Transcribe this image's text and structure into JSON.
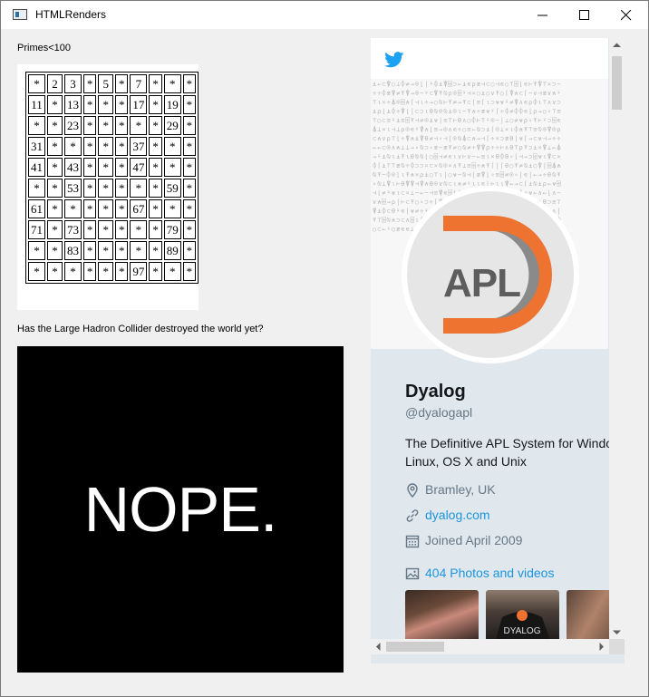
{
  "window": {
    "title": "HTMLRenders"
  },
  "primes": {
    "caption": "Primes<100",
    "rows": [
      [
        "*",
        "2",
        "3",
        "*",
        "5",
        "*",
        "7",
        "*",
        "*",
        "*"
      ],
      [
        "11",
        "*",
        "13",
        "*",
        "*",
        "*",
        "17",
        "*",
        "19",
        "*"
      ],
      [
        "*",
        "*",
        "23",
        "*",
        "*",
        "*",
        "*",
        "*",
        "29",
        "*"
      ],
      [
        "31",
        "*",
        "*",
        "*",
        "*",
        "*",
        "37",
        "*",
        "*",
        "*"
      ],
      [
        "41",
        "*",
        "43",
        "*",
        "*",
        "*",
        "47",
        "*",
        "*",
        "*"
      ],
      [
        "*",
        "*",
        "53",
        "*",
        "*",
        "*",
        "*",
        "*",
        "59",
        "*"
      ],
      [
        "61",
        "*",
        "*",
        "*",
        "*",
        "*",
        "67",
        "*",
        "*",
        "*"
      ],
      [
        "71",
        "*",
        "73",
        "*",
        "*",
        "*",
        "*",
        "*",
        "79",
        "*"
      ],
      [
        "*",
        "*",
        "83",
        "*",
        "*",
        "*",
        "*",
        "*",
        "89",
        "*"
      ],
      [
        "*",
        "*",
        "*",
        "*",
        "*",
        "*",
        "97",
        "*",
        "*",
        "*"
      ]
    ]
  },
  "lhc": {
    "caption": "Has the Large Hadron Collider destroyed the world yet?",
    "answer": "NOPE."
  },
  "twitter": {
    "avatar_text": "APL",
    "name": "Dyalog",
    "handle": "@dyalogapl",
    "bio_line1": "The Definitive APL System for Windows,",
    "bio_line2": "Linux, OS X and Unix",
    "location": "Bramley, UK",
    "website": "dyalog.com",
    "joined": "Joined April 2009",
    "media": "404 Photos and videos",
    "brand_color": "#1da1f2",
    "apl_orange": "#ee7330",
    "icons": [
      "twitter-bird-icon",
      "location-pin-icon",
      "link-icon",
      "calendar-icon",
      "photo-icon"
    ]
  }
}
